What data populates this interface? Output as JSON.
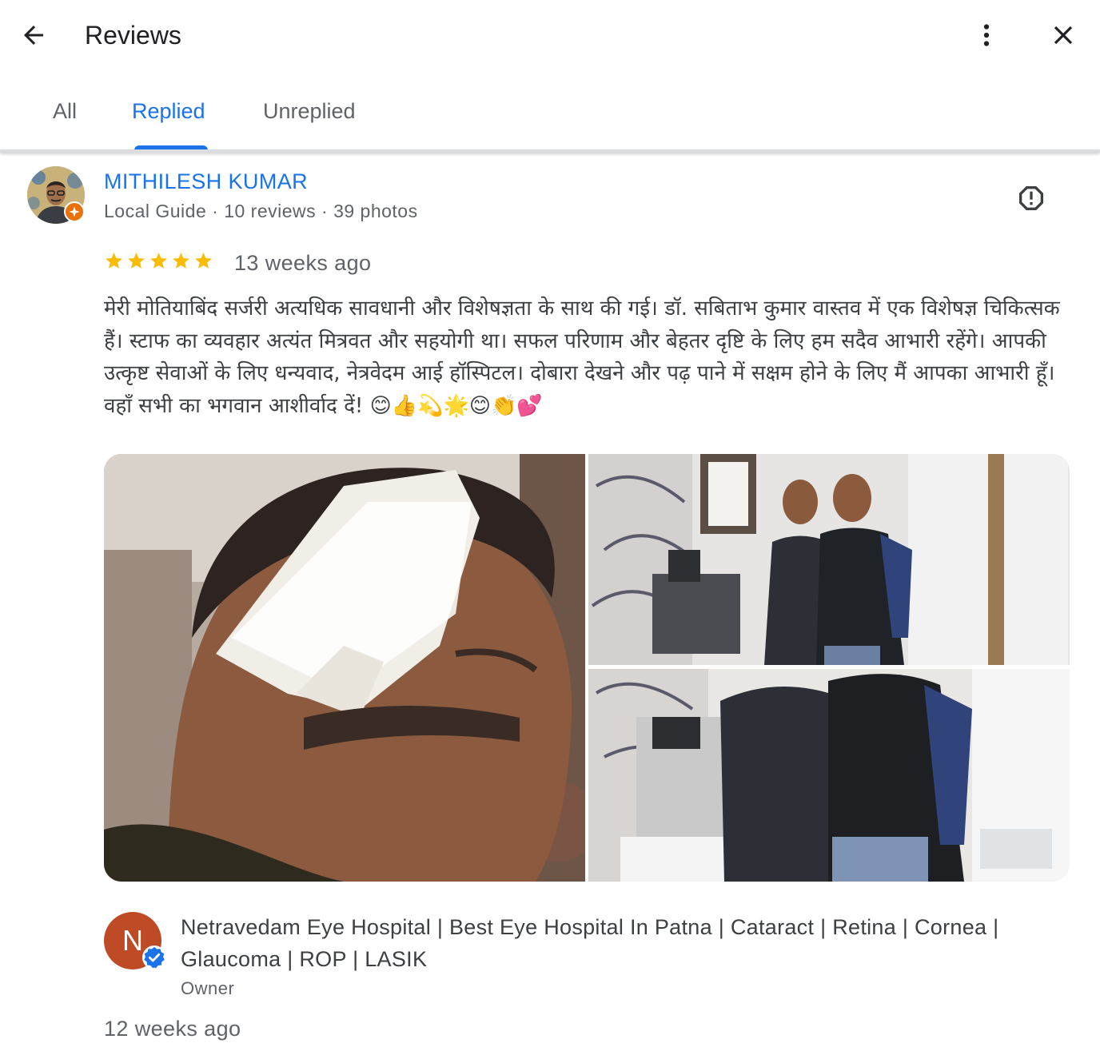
{
  "header": {
    "title": "Reviews",
    "back_icon": "arrow-back-icon",
    "more_icon": "more-vert-icon",
    "close_icon": "close-icon"
  },
  "tabs": [
    {
      "label": "All",
      "active": false
    },
    {
      "label": "Replied",
      "active": true
    },
    {
      "label": "Unreplied",
      "active": false
    }
  ],
  "review": {
    "reviewer_name": "MITHILESH KUMAR",
    "reviewer_meta": "Local Guide · 10 reviews · 39 photos",
    "rating": 5,
    "time": "13 weeks ago",
    "text": "मेरी मोतियाबिंद सर्जरी अत्यधिक सावधानी और विशेषज्ञता के साथ की गई। डॉ. सबिताभ कुमार वास्तव में एक विशेषज्ञ चिकित्सक हैं। स्टाफ का व्यवहार अत्यंत मित्रवत और सहयोगी था। सफल परिणाम और बेहतर दृष्टि के लिए हम सदैव आभारी रहेंगे। आपकी उत्कृष्ट सेवाओं के लिए धन्यवाद, नेत्रवेदम आई हॉस्पिटल। दोबारा देखने और पढ़ पाने में सक्षम होने के लिए मैं आपका आभारी हूँ। वहाँ सभी का भगवान आशीर्वाद दें! 😊👍💫🌟😊👏💕",
    "report_icon": "report-icon"
  },
  "owner_reply": {
    "avatar_letter": "N",
    "name": "Netravedam Eye Hospital | Best Eye Hospital In Patna | Cataract | Retina | Cornea | Glaucoma | ROP | LASIK",
    "role": "Owner",
    "time": "12 weeks ago"
  },
  "colors": {
    "accent": "#1a73e8",
    "star": "#fbbc04",
    "owner_avatar": "#bf4a26",
    "guide_badge": "#e8710a",
    "text_secondary": "#5f6368"
  }
}
